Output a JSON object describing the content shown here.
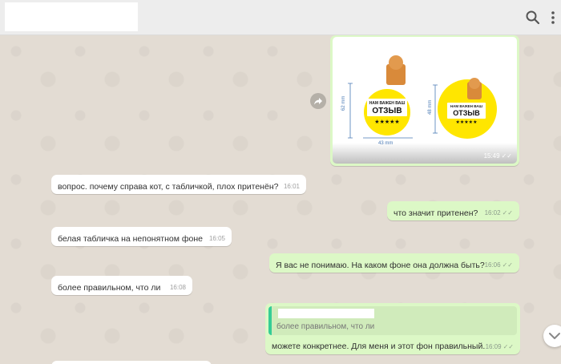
{
  "header": {
    "search_icon": "search-icon",
    "menu_icon": "more-vertical-icon"
  },
  "image_message": {
    "time": "15:49",
    "sticker_large": {
      "line1": "НАМ ВАЖЕН ВАШ",
      "line2": "ОТЗЫВ",
      "stars": "★★★★★",
      "height": "62 mm",
      "width": "43 mm"
    },
    "sticker_small": {
      "line1": "НАМ ВАЖЕН ВАШ",
      "line2": "ОТЗЫВ",
      "stars": "★★★★★",
      "height": "48 mm"
    },
    "colors": {
      "yellow": "#ffe600",
      "dim": "#4a7ab5"
    }
  },
  "messages": [
    {
      "dir": "in",
      "text": "вопрос. почему справа кот, с табличкой, плох притенён?",
      "time": "16:01"
    },
    {
      "dir": "out",
      "text": "что значит притенен?",
      "time": "16:02"
    },
    {
      "dir": "in",
      "text": "белая табличка на непонятном фоне",
      "time": "16:05"
    },
    {
      "dir": "out",
      "text": "Я вас не понимаю. На каком фоне она должна быть?",
      "time": "16:06"
    },
    {
      "dir": "in",
      "text": "более правильном, что ли",
      "time": "16:08"
    },
    {
      "dir": "out",
      "text": "можете конкретнее. Для меня и этот фон правильный.",
      "time": "16:09",
      "quote": "более правильном, что ли"
    }
  ],
  "ticks": "✓✓"
}
